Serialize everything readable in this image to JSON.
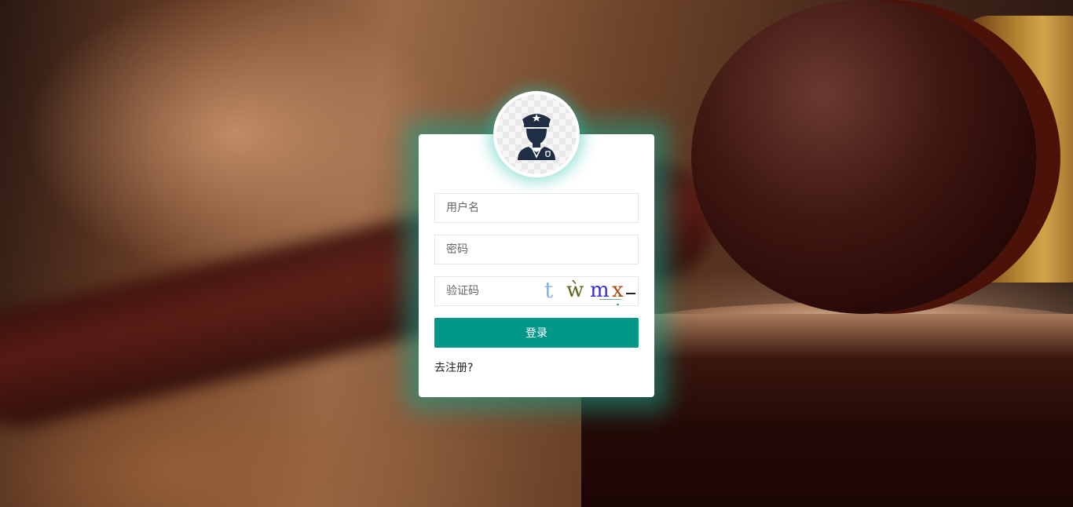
{
  "login_form": {
    "username_placeholder": "用户名",
    "password_placeholder": "密码",
    "captcha_placeholder": "验证码",
    "captcha_chars": [
      "t",
      "ẁ",
      "m",
      "x"
    ],
    "login_label": "登录",
    "register_label": "去注册?"
  },
  "avatar": {
    "icon": "police-officer-icon"
  },
  "colors": {
    "accent": "#009688",
    "glow": "#14a08c"
  }
}
